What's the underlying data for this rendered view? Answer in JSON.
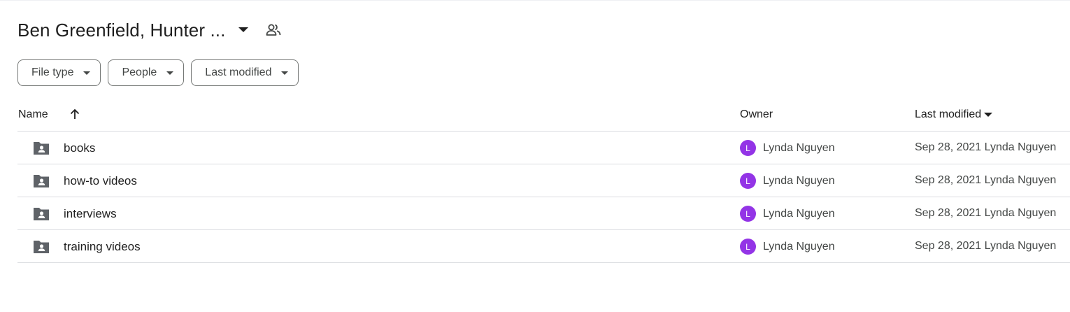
{
  "header": {
    "title": "Ben Greenfield, Hunter ..."
  },
  "filters": [
    {
      "label": "File type"
    },
    {
      "label": "People"
    },
    {
      "label": "Last modified"
    }
  ],
  "table": {
    "columns": {
      "name": "Name",
      "owner": "Owner",
      "modified": "Last modified"
    },
    "rows": [
      {
        "name": "books",
        "owner_initial": "L",
        "owner": "Lynda Nguyen",
        "modified": "Sep 28, 2021 Lynda Nguyen"
      },
      {
        "name": "how-to videos",
        "owner_initial": "L",
        "owner": "Lynda Nguyen",
        "modified": "Sep 28, 2021 Lynda Nguyen"
      },
      {
        "name": "interviews",
        "owner_initial": "L",
        "owner": "Lynda Nguyen",
        "modified": "Sep 28, 2021 Lynda Nguyen"
      },
      {
        "name": "training videos",
        "owner_initial": "L",
        "owner": "Lynda Nguyen",
        "modified": "Sep 28, 2021 Lynda Nguyen"
      }
    ]
  },
  "colors": {
    "avatar": "#9334e6",
    "icon": "#5f6368",
    "border": "#dadce0"
  },
  "icons": {
    "title_dropdown": "arrow-drop-down-icon",
    "share": "people-icon",
    "sort": "arrow-upward-icon",
    "folder": "shared-folder-icon"
  }
}
